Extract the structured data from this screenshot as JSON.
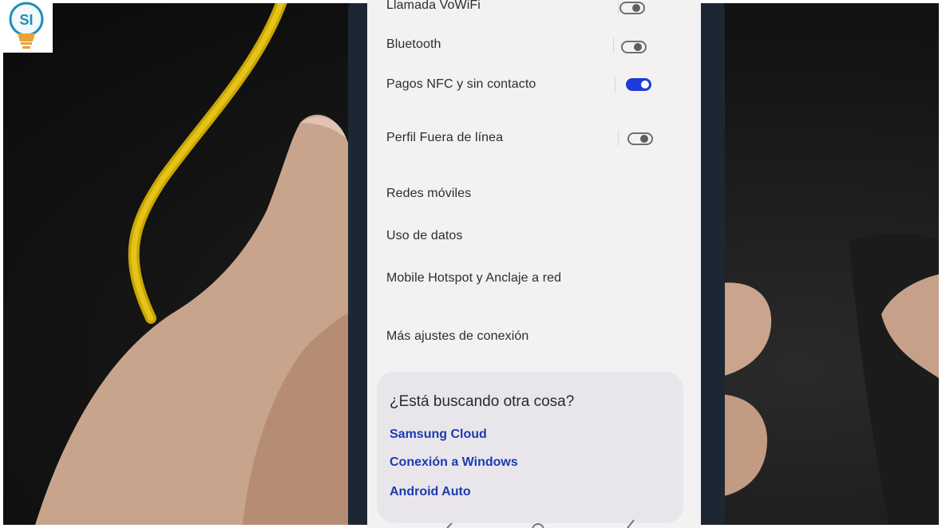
{
  "logo": {
    "text": "SI",
    "icon": "lightbulb-icon"
  },
  "settings": {
    "items": [
      {
        "label": "Llamada VoWiFi",
        "toggle": false
      },
      {
        "label": "Bluetooth",
        "toggle": false
      },
      {
        "label": "Pagos NFC y sin contacto",
        "toggle": true
      },
      {
        "label": "Perfil Fuera de línea",
        "toggle": false
      },
      {
        "label": "Redes móviles"
      },
      {
        "label": "Uso de datos"
      },
      {
        "label": "Mobile Hotspot y Anclaje a red"
      },
      {
        "label": "Más ajustes de conexión"
      }
    ]
  },
  "suggestions": {
    "title": "¿Está buscando otra cosa?",
    "links": [
      "Samsung Cloud",
      "Conexión a Windows",
      "Android Auto"
    ]
  },
  "colors": {
    "accent": "#1f3ad8",
    "link": "#1b3cb0",
    "screen_bg": "#f4f1f3",
    "card_bg": "#e9e6eb"
  }
}
